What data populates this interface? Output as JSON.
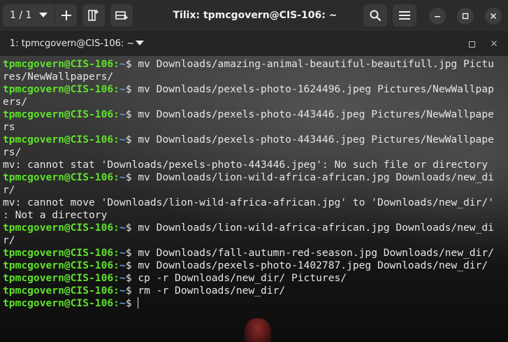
{
  "header": {
    "session_counter": "1 / 1",
    "window_title": "Tilix: tpmcgovern@CIS-106: ~"
  },
  "terminal_tab": {
    "title": "1: tpmcgovern@CIS-106: ~"
  },
  "terminal": {
    "prompt_user": "tpmcgovern@CIS-106",
    "prompt_sep": ":",
    "prompt_path": "~",
    "prompt_symbol": "$ ",
    "lines": [
      {
        "type": "prompt",
        "cmd": "mv Downloads/amazing-animal-beautiful-beautifull.jpg Pictu"
      },
      {
        "type": "output",
        "text": "res/NewWallpapers/"
      },
      {
        "type": "prompt",
        "cmd": "mv Downloads/pexels-photo-1624496.jpeg Pictures/NewWallpap"
      },
      {
        "type": "output",
        "text": "ers/"
      },
      {
        "type": "prompt",
        "cmd": "mv Downloads/pexels-photo-443446.jpeg Pictures/NewWallpape"
      },
      {
        "type": "output",
        "text": "rs"
      },
      {
        "type": "prompt",
        "cmd": "mv Downloads/pexels-photo-443446.jpeg Pictures/NewWallpape"
      },
      {
        "type": "output",
        "text": "rs/"
      },
      {
        "type": "output",
        "text": "mv: cannot stat 'Downloads/pexels-photo-443446.jpeg': No such file or directory"
      },
      {
        "type": "prompt",
        "cmd": "mv Downloads/lion-wild-africa-african.jpg Downloads/new_di"
      },
      {
        "type": "output",
        "text": "r/"
      },
      {
        "type": "output",
        "text": "mv: cannot move 'Downloads/lion-wild-africa-african.jpg' to 'Downloads/new_dir/'"
      },
      {
        "type": "output",
        "text": ": Not a directory"
      },
      {
        "type": "prompt",
        "cmd": "mv Downloads/lion-wild-africa-african.jpg Downloads/new_di"
      },
      {
        "type": "output",
        "text": "r/"
      },
      {
        "type": "prompt",
        "cmd": "mv Downloads/fall-autumn-red-season.jpg Downloads/new_dir/"
      },
      {
        "type": "prompt",
        "cmd": "mv Downloads/pexels-photo-1402787.jpeg Downloads/new_dir/"
      },
      {
        "type": "prompt",
        "cmd": "cp -r Downloads/new_dir/ Pictures/"
      },
      {
        "type": "prompt",
        "cmd": "rm -r Downloads/new_dir/"
      },
      {
        "type": "prompt",
        "cmd": "",
        "cursor": true
      }
    ]
  },
  "colors": {
    "prompt_user": "#5fe22b",
    "prompt_path": "#6c9be0",
    "text": "#e6e6e6",
    "headerbar": "#2b2b2b"
  },
  "icons": {
    "session_menu": "chevron-down-icon",
    "add_session": "plus-icon",
    "add_right": "split-right-icon",
    "add_down": "split-down-icon",
    "search": "search-icon",
    "menu": "hamburger-menu-icon",
    "minimize": "minimize-icon",
    "maximize": "maximize-icon",
    "close": "close-icon"
  }
}
